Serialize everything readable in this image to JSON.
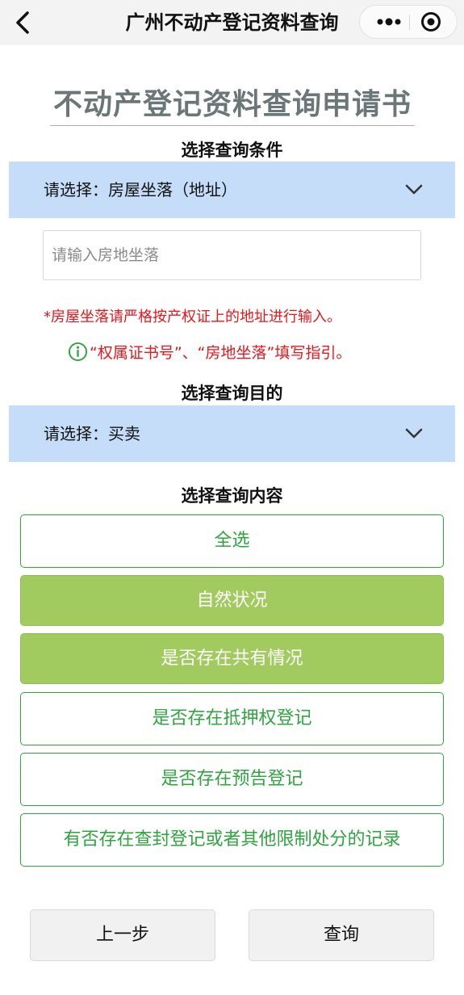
{
  "navbar": {
    "title": "广州不动产登记资料查询",
    "back_icon": "chevron-left-icon",
    "more_icon": "more-dots-icon",
    "close_icon": "target-circle-icon"
  },
  "form": {
    "title": "不动产登记资料查询申请书"
  },
  "condition": {
    "label": "选择查询条件",
    "select_value": "请选择：房屋坐落（地址）",
    "input_placeholder": "请输入房地坐落",
    "input_value": "",
    "warning": "*房屋坐落请严格按产权证上的地址进行输入。",
    "guide_text": "“权属证书号”、“房地坐落”填写指引。"
  },
  "purpose": {
    "label": "选择查询目的",
    "select_value": "请选择：买卖"
  },
  "content": {
    "label": "选择查询内容",
    "options": [
      {
        "label": "全选",
        "selected": false
      },
      {
        "label": "自然状况",
        "selected": true
      },
      {
        "label": "是否存在共有情况",
        "selected": true
      },
      {
        "label": "是否存在抵押权登记",
        "selected": false
      },
      {
        "label": "是否存在预告登记",
        "selected": false
      },
      {
        "label": "有否存在查封登记或者其他限制处分的记录",
        "selected": false
      }
    ]
  },
  "buttons": {
    "prev": "上一步",
    "query": "查询"
  },
  "colors": {
    "accent_green": "#2fa540",
    "selected_green": "#a1cb5e",
    "select_blue": "#c5ddf8",
    "warning_red": "#e8161b"
  }
}
